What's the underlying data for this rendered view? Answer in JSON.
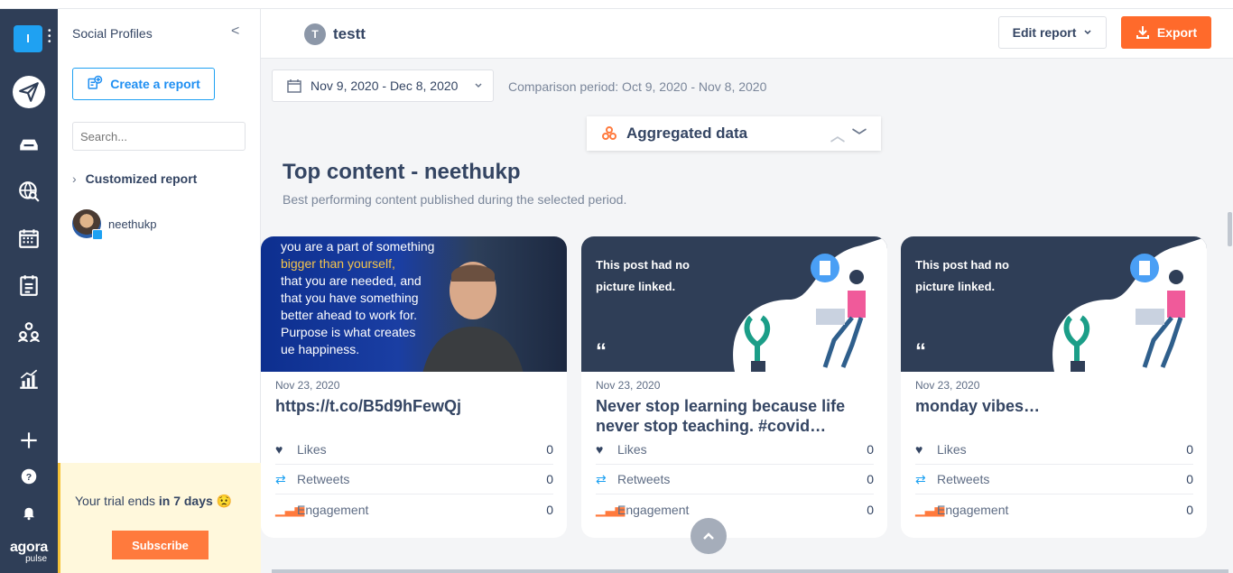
{
  "nav": {
    "workspace_initial": "I",
    "brand_line1": "agora",
    "brand_line2": "pulse"
  },
  "panel": {
    "title": "Social Profiles",
    "collapse_glyph": "<",
    "create_report": "Create a report",
    "search_placeholder": "Search...",
    "customized_report": "Customized report",
    "profile_name": "neethukp",
    "trial_text_pre": "Your trial ends ",
    "trial_text_bold": "in 7 days",
    "trial_emoji": "😟",
    "subscribe": "Subscribe"
  },
  "header": {
    "report_initial": "T",
    "report_name": "testt",
    "edit_report": "Edit report",
    "export": "Export"
  },
  "main": {
    "date_range": "Nov 9, 2020 - Dec 8, 2020",
    "comparison": "Comparison period: Oct 9, 2020 - Nov 8, 2020",
    "aggregated": "Aggregated data",
    "section_title": "Top content - neethukp",
    "section_subtitle": "Best performing content published during the selected period."
  },
  "cards": [
    {
      "date": "Nov 23, 2020",
      "title": "https://t.co/B5d9hFewQj",
      "quote_lines": [
        "you are a part of something",
        "bigger than yourself,",
        "that you are needed, and",
        "that you have something",
        "better ahead to work for.",
        "Purpose is what creates",
        "ue happiness."
      ],
      "likes_label": "Likes",
      "likes": "0",
      "retweets_label": "Retweets",
      "retweets": "0",
      "engagement_label": "Engagement",
      "engagement": "0"
    },
    {
      "date": "Nov 23, 2020",
      "title": "Never stop learning because life never stop teaching. #covid…",
      "nopic_text": "This post had no picture linked.",
      "likes_label": "Likes",
      "likes": "0",
      "retweets_label": "Retweets",
      "retweets": "0",
      "engagement_label": "Engagement",
      "engagement": "0"
    },
    {
      "date": "Nov 23, 2020",
      "title": "monday vibes…",
      "nopic_text": "This post had no picture linked.",
      "likes_label": "Likes",
      "likes": "0",
      "retweets_label": "Retweets",
      "retweets": "0",
      "engagement_label": "Engagement",
      "engagement": "0"
    }
  ],
  "colors": {
    "nav_bg": "#2f3e57",
    "accent_blue": "#1fa1f2",
    "export_orange": "#ff6a2b",
    "trial_bg": "#fff8dc",
    "twitter_blue": "#1da1f2"
  },
  "icons": {
    "nav": [
      "publish-icon",
      "inbox-icon",
      "listening-icon",
      "calendar-icon",
      "reports-icon",
      "team-icon",
      "analytics-icon",
      "add-icon",
      "help-icon",
      "bell-icon"
    ],
    "likes": "heart-icon",
    "retweets": "retweet-icon",
    "engagement": "bar-chart-icon"
  }
}
